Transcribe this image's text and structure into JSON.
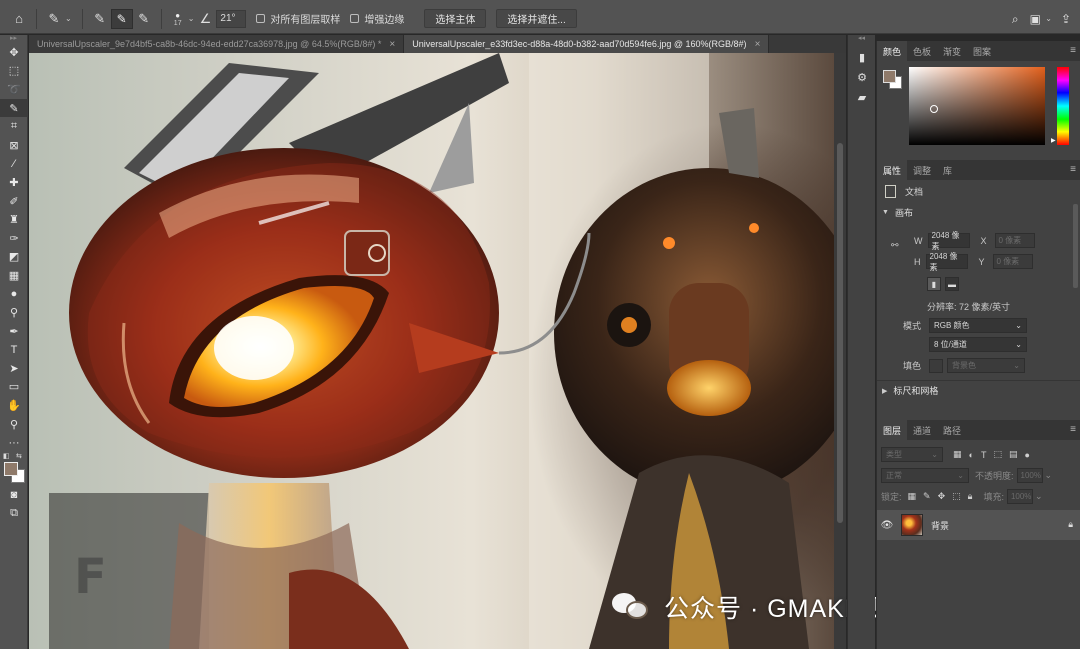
{
  "options_bar": {
    "brush_size": "17",
    "angle_value": "21°",
    "sample_all_layers_label": "对所有图层取样",
    "enhance_edge_label": "增强边缘",
    "select_subject_label": "选择主体",
    "select_and_mask_label": "选择并遮住..."
  },
  "document_tabs": [
    {
      "label": "UniversalUpscaler_9e7d4bf5-ca8b-46dc-94ed-edd27ca36978.jpg @ 64.5%(RGB/8#) *",
      "active": false
    },
    {
      "label": "UniversalUpscaler_e33fd3ec-d88a-48d0-b382-aad70d594fe6.jpg @ 160%(RGB/8#)",
      "active": true
    }
  ],
  "color_panel": {
    "tabs": [
      "颜色",
      "色板",
      "渐变",
      "图案"
    ],
    "foreground": "#8f7a6a",
    "background": "#ffffff"
  },
  "properties_panel": {
    "tabs": [
      "属性",
      "调整",
      "库"
    ],
    "document_label": "文档",
    "canvas_section": "画布",
    "width_label": "W",
    "width_value": "2048 像素",
    "x_label": "X",
    "x_placeholder": "0 像素",
    "height_label": "H",
    "height_value": "2048 像素",
    "y_label": "Y",
    "y_placeholder": "0 像素",
    "resolution": "分辨率: 72 像素/英寸",
    "mode_label": "模式",
    "mode_value": "RGB 颜色",
    "depth_value": "8 位/通道",
    "fill_label": "填色",
    "fill_value": "背景色",
    "rulers_section": "标尺和网格"
  },
  "layers_panel": {
    "tabs": [
      "图层",
      "通道",
      "路径"
    ],
    "filter_kind": "类型",
    "blend_mode": "正常",
    "opacity_label": "不透明度:",
    "opacity_value": "100%",
    "lock_label": "锁定:",
    "fill_label": "填充:",
    "fill_value": "100%",
    "layers": [
      {
        "name": "背景",
        "visible": true,
        "locked": true
      }
    ]
  },
  "watermark": {
    "text": "公众号 · GMAKE视觉研究所"
  },
  "icons": {
    "left_tools": [
      "move-icon",
      "marquee-icon",
      "lasso-icon",
      "quick-selection-icon",
      "crop-icon",
      "frame-icon",
      "eyedropper-icon",
      "healing-brush-icon",
      "brush-icon",
      "clone-stamp-icon",
      "history-brush-icon",
      "eraser-icon",
      "gradient-icon",
      "blur-icon",
      "dodge-icon",
      "pen-icon",
      "type-icon",
      "path-selection-icon",
      "rectangle-icon",
      "hand-icon",
      "zoom-icon",
      "more-tools-icon"
    ]
  }
}
